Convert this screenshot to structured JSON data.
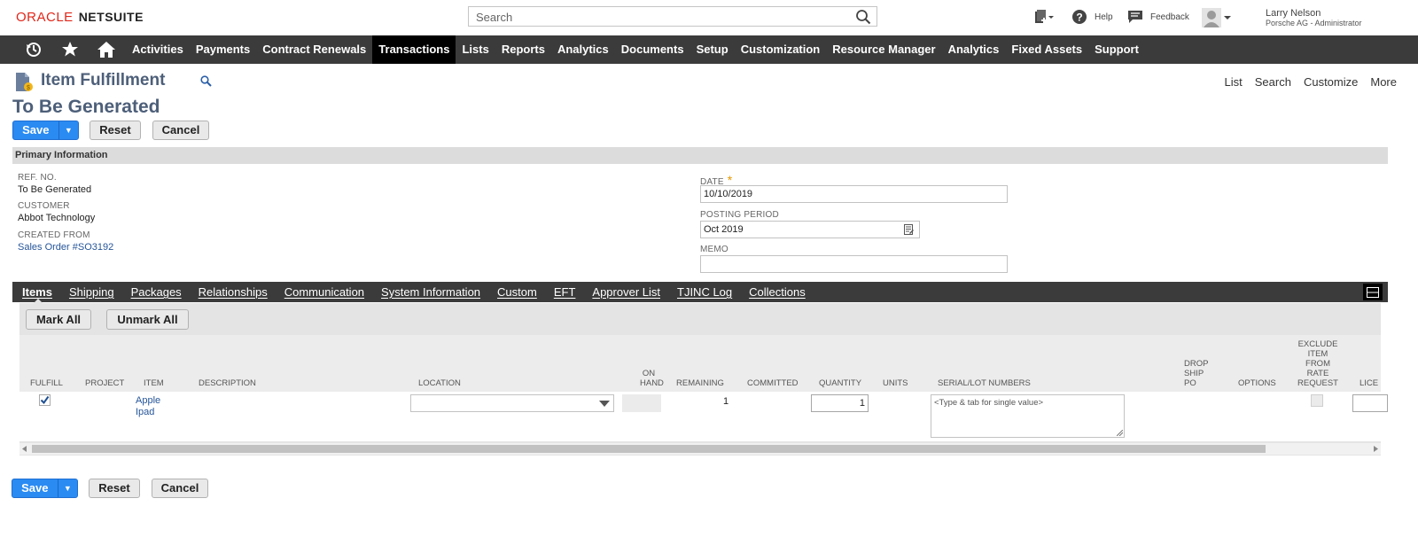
{
  "header": {
    "logo_oracle": "ORACLE",
    "logo_netsuite": "NETSUITE",
    "search_placeholder": "Search",
    "help_label": "Help",
    "feedback_label": "Feedback",
    "user_name": "Larry Nelson",
    "user_role": "Porsche AG - Administrator"
  },
  "nav": {
    "items": [
      "Activities",
      "Payments",
      "Contract Renewals",
      "Transactions",
      "Lists",
      "Reports",
      "Analytics",
      "Documents",
      "Setup",
      "Customization",
      "Resource Manager",
      "Analytics",
      "Fixed Assets",
      "Support"
    ],
    "active": "Transactions"
  },
  "page": {
    "title": "Item Fulfillment",
    "record_name": "To Be Generated",
    "links": [
      "List",
      "Search",
      "Customize",
      "More"
    ]
  },
  "buttons": {
    "save": "Save",
    "save_arrow": "▼",
    "reset": "Reset",
    "cancel": "Cancel",
    "mark_all": "Mark All",
    "unmark_all": "Unmark All"
  },
  "primary": {
    "section_title": "Primary Information",
    "ref_no_label": "REF. NO.",
    "ref_no_value": "To Be Generated",
    "customer_label": "CUSTOMER",
    "customer_value": "Abbot Technology",
    "created_from_label": "CREATED FROM",
    "created_from_value": "Sales Order #SO3192",
    "date_label": "DATE",
    "required_mark": "*",
    "date_value": "10/10/2019",
    "posting_period_label": "POSTING PERIOD",
    "posting_period_value": "Oct 2019",
    "memo_label": "MEMO",
    "memo_value": ""
  },
  "subtabs": [
    "Items",
    "Shipping",
    "Packages",
    "Relationships",
    "Communication",
    "System Information",
    "Custom",
    "EFT",
    "Approver List",
    "TJINC Log",
    "Collections"
  ],
  "grid": {
    "columns": {
      "fulfill": "FULFILL",
      "project": "PROJECT",
      "item": "ITEM",
      "description": "DESCRIPTION",
      "location": "LOCATION",
      "on_hand_1": "ON",
      "on_hand_2": "HAND",
      "remaining": "REMAINING",
      "committed": "COMMITTED",
      "quantity": "QUANTITY",
      "units": "UNITS",
      "serial": "SERIAL/LOT NUMBERS",
      "drop_1": "DROP",
      "drop_2": "SHIP",
      "drop_3": "PO",
      "options": "OPTIONS",
      "excl_1": "EXCLUDE",
      "excl_2": "ITEM",
      "excl_3": "FROM",
      "excl_4": "RATE",
      "excl_5": "REQUEST",
      "lice": "LICE"
    },
    "row": {
      "item_line1": "Apple",
      "item_line2": "Ipad",
      "remaining": "1",
      "quantity": "1",
      "serial_placeholder": "<Type & tab for single value>"
    }
  }
}
